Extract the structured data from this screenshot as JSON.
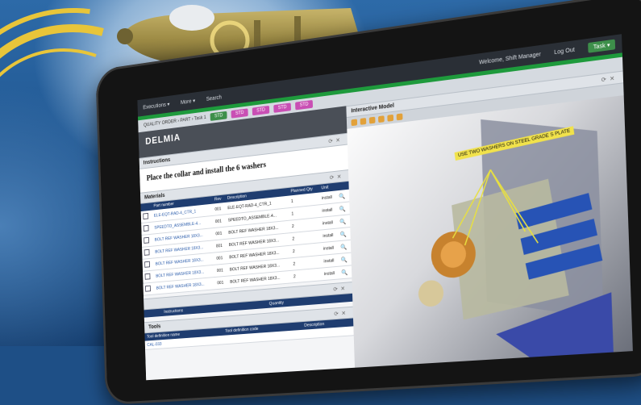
{
  "app": {
    "brand": "DELMIA",
    "window_title": "Welcome, Shift Manager"
  },
  "topbar": {
    "items": [
      "Executions ▾",
      "More ▾",
      "Search"
    ],
    "user": "Welcome, Shift Manager",
    "logout": "Log Out",
    "task_button": "Task ▾"
  },
  "subbar": {
    "breadcrumb": "QUALITY ORDER › PART › Task 1",
    "tabs": [
      "STD",
      "STD",
      "STD",
      "STD",
      "STD"
    ]
  },
  "instructions": {
    "header": "Instructions",
    "text": "Place the collar and install the 6 washers"
  },
  "materials": {
    "header": "Materials",
    "columns": [
      "Part number",
      "Rev",
      "Alternate",
      "Description",
      "Planned Qty",
      "Unit"
    ],
    "rows": [
      {
        "part": "ELE-EQT-RAD-4_CTR_1",
        "rev": "001",
        "alt": "",
        "desc": "ELE-EQT-RAD-4_CTR_1",
        "qty": "1",
        "unit": "install"
      },
      {
        "part": "SPEEDTO_ASSEMBLE-4...",
        "rev": "001",
        "alt": "",
        "desc": "SPEEDTO_ASSEMBLE-4...",
        "qty": "1",
        "unit": "install"
      },
      {
        "part": "BOLT REF WASHER 18X3...",
        "rev": "001",
        "alt": "",
        "desc": "BOLT REF WASHER 18X3...",
        "qty": "2",
        "unit": "install"
      },
      {
        "part": "BOLT REF WASHER 18X3...",
        "rev": "001",
        "alt": "",
        "desc": "BOLT REF WASHER 18X3...",
        "qty": "2",
        "unit": "install"
      },
      {
        "part": "BOLT REF WASHER 18X3...",
        "rev": "001",
        "alt": "",
        "desc": "BOLT REF WASHER 18X3...",
        "qty": "2",
        "unit": "install"
      },
      {
        "part": "BOLT REF WASHER 18X3...",
        "rev": "001",
        "alt": "",
        "desc": "BOLT REF WASHER 18X3...",
        "qty": "2",
        "unit": "install"
      },
      {
        "part": "BOLT REF WASHER 18X3...",
        "rev": "001",
        "alt": "",
        "desc": "BOLT REF WASHER 18X3...",
        "qty": "2",
        "unit": "install"
      }
    ]
  },
  "consumables": {
    "columns": [
      "",
      "Instructions",
      "Quantity"
    ]
  },
  "tools": {
    "header": "Tools",
    "columns": [
      "Tool definition name",
      "Tool definition code",
      "Description"
    ],
    "first_row": "CAL-033"
  },
  "viewer": {
    "header": "Interactive Model",
    "callout": "USE TWO WASHERS ON STEEL GRADE S PLATE"
  },
  "colors": {
    "accent_green": "#1e9a3c",
    "table_header": "#1f3d70",
    "tab_magenta": "#c94fb4"
  }
}
